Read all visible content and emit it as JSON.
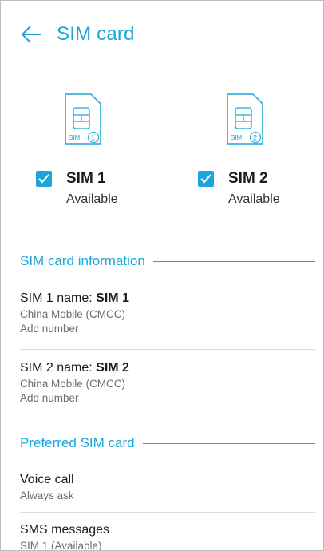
{
  "header": {
    "title": "SIM card",
    "back_icon": "arrow-left-icon"
  },
  "sims": [
    {
      "icon_label": "SIM",
      "slot": "1",
      "name": "SIM 1",
      "status": "Available",
      "checked": true
    },
    {
      "icon_label": "SIM",
      "slot": "2",
      "name": "SIM 2",
      "status": "Available",
      "checked": true
    }
  ],
  "info_section": {
    "title": "SIM card information",
    "items": [
      {
        "name_prefix": "SIM 1 name: ",
        "name_value": "SIM 1",
        "carrier": "China Mobile (CMCC)",
        "number": "Add number"
      },
      {
        "name_prefix": "SIM 2 name: ",
        "name_value": "SIM 2",
        "carrier": "China Mobile (CMCC)",
        "number": "Add number"
      }
    ]
  },
  "preferred_section": {
    "title": "Preferred SIM card",
    "items": [
      {
        "label": "Voice call",
        "value": "Always ask"
      },
      {
        "label": "SMS messages",
        "value": "SIM 1 (Available)"
      }
    ]
  },
  "colors": {
    "accent": "#1aa6d8",
    "primary_text": "#1b1b1b",
    "secondary_text": "#6d6d6d"
  }
}
